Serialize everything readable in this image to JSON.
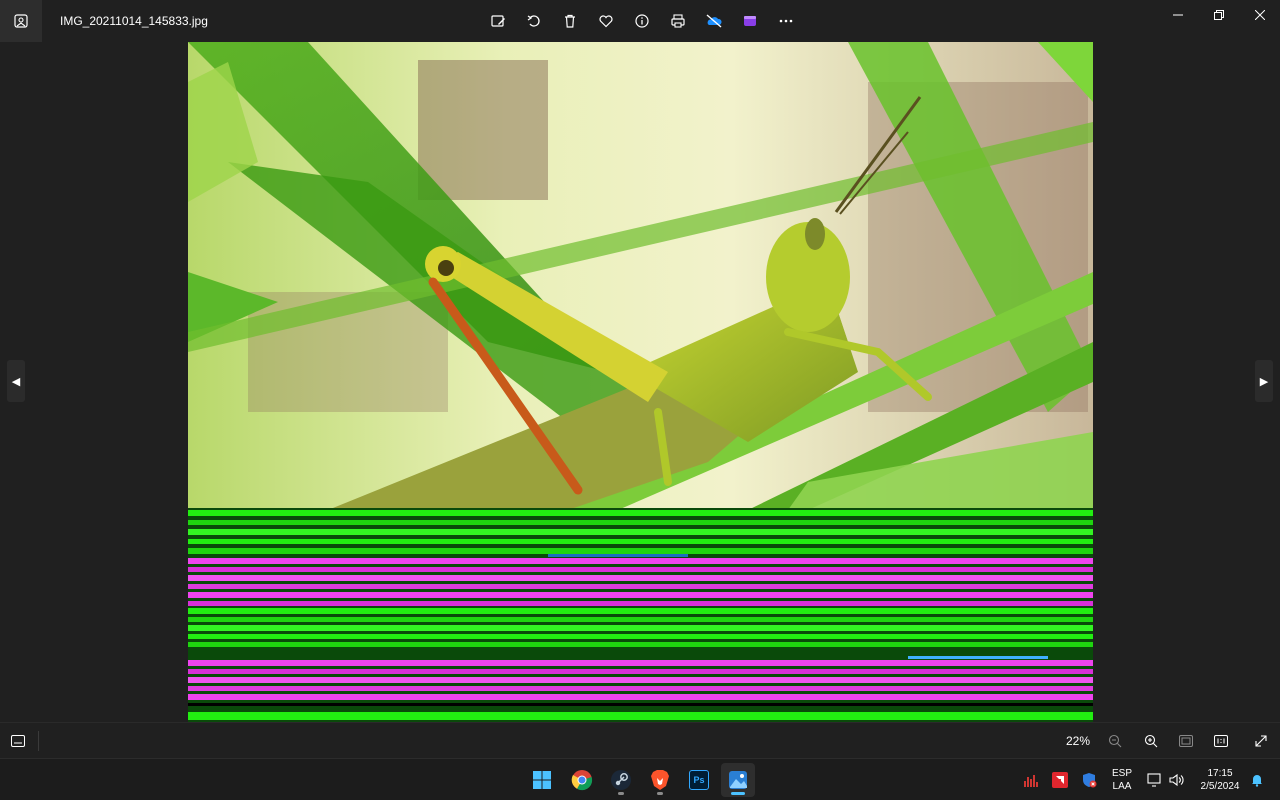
{
  "window": {
    "filename": "IMG_20211014_145833.jpg",
    "app_icon": "photos-app-icon"
  },
  "toolbar": {
    "items": [
      {
        "name": "edit-image-icon"
      },
      {
        "name": "rotate-icon"
      },
      {
        "name": "delete-icon"
      },
      {
        "name": "favorite-heart-icon"
      },
      {
        "name": "info-icon"
      },
      {
        "name": "print-icon"
      },
      {
        "name": "onedrive-off-icon"
      },
      {
        "name": "clipchamp-icon"
      },
      {
        "name": "more-options-icon"
      }
    ]
  },
  "window_controls": [
    "minimize-icon",
    "restore-icon",
    "close-icon"
  ],
  "viewer": {
    "prev_glyph": "◀",
    "next_glyph": "▶",
    "image_subject": "grasshopper on green leaves",
    "corruption_colors": [
      "#22ee11",
      "#ee33ee",
      "#007a00"
    ]
  },
  "statusbar": {
    "zoom": "22%"
  },
  "taskbar": {
    "apps": [
      {
        "name": "start-button"
      },
      {
        "name": "chrome-app"
      },
      {
        "name": "steam-app"
      },
      {
        "name": "brave-app"
      },
      {
        "name": "photoshop-app",
        "label": "Ps"
      },
      {
        "name": "photos-app"
      }
    ],
    "lang_top": "ESP",
    "lang_bottom": "LAA",
    "time": "17:15",
    "date": "2/5/2024"
  },
  "colors": {
    "background": "#202020",
    "taskbar": "#1c1c1c",
    "accent": "#4cc2ff",
    "leaf_green": "#5fbf1f",
    "grasshopper": "#a8c92a"
  }
}
